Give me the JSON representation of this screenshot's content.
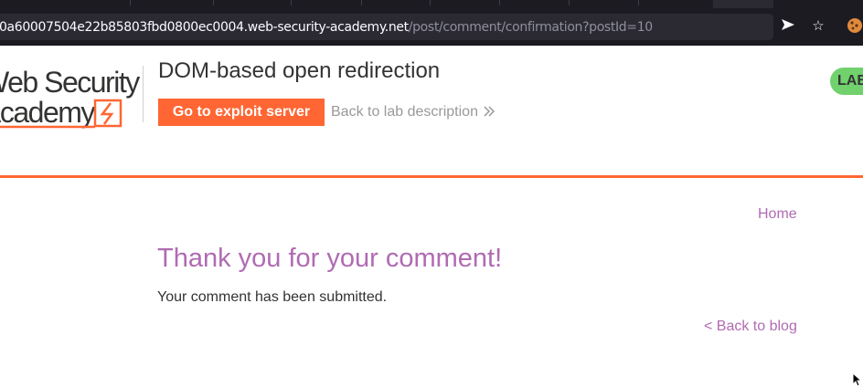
{
  "browser": {
    "url_host": "0a60007504e22b85803fbd0800ec0004.web-security-academy.net",
    "url_path": "/post/comment/confirmation?postId=10",
    "icons": [
      "send-icon",
      "bookmark-star-icon",
      "cookie-extension-icon"
    ]
  },
  "header": {
    "logo_line1": "Web Security",
    "logo_line2": "Academy",
    "lab_title": "DOM-based open redirection",
    "exploit_button": "Go to exploit server",
    "back_to_lab": "Back to lab description",
    "status_badge": "LAB"
  },
  "nav": {
    "home": "Home"
  },
  "main": {
    "title": "Thank you for your comment!",
    "message": "Your comment has been submitted.",
    "back_link": "< Back to blog"
  },
  "colors": {
    "accent_orange": "#ff6633",
    "link_purple": "#b06bb3",
    "badge_green": "#70d16d",
    "chrome_dark": "#1c1b22"
  }
}
